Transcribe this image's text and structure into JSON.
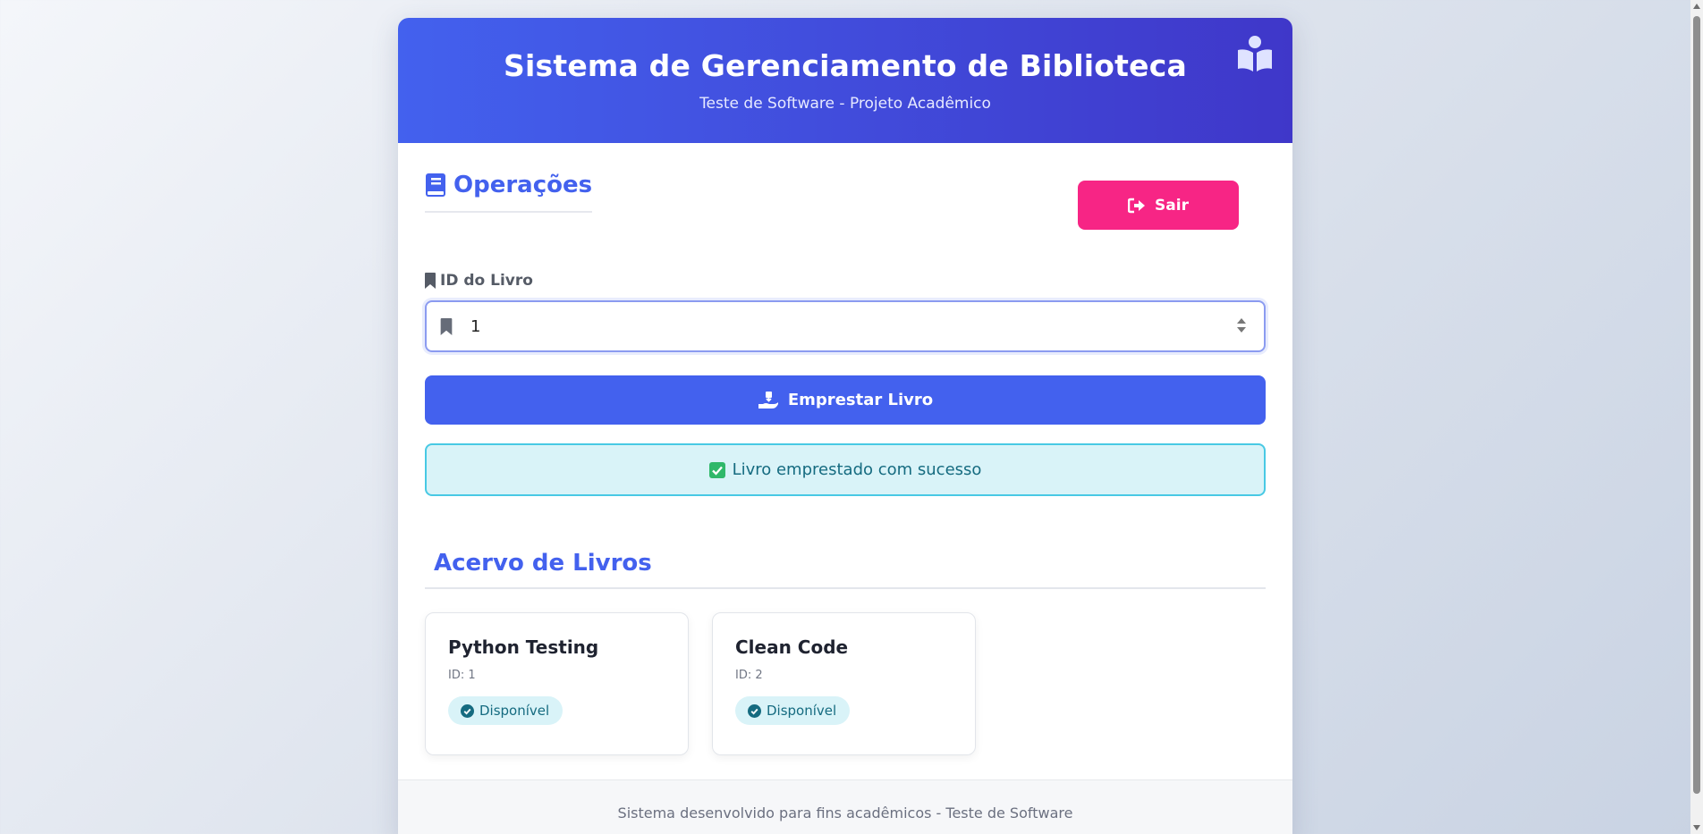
{
  "header": {
    "title": "Sistema de Gerenciamento de Biblioteca",
    "subtitle": "Teste de Software - Projeto Acadêmico"
  },
  "operations": {
    "title": "Operações",
    "logout_label": "Sair"
  },
  "form": {
    "book_id_label": "ID do Livro",
    "book_id_value": "1",
    "lend_button_label": "Emprestar Livro"
  },
  "alert": {
    "message": "Livro emprestado com sucesso"
  },
  "collection": {
    "title": "Acervo de Livros",
    "books": [
      {
        "title": "Python Testing",
        "id_text": "ID: 1",
        "status": "Disponível"
      },
      {
        "title": "Clean Code",
        "id_text": "ID: 2",
        "status": "Disponível"
      }
    ]
  },
  "footer": {
    "text": "Sistema desenvolvido para fins acadêmicos - Teste de Software"
  },
  "colors": {
    "primary": "#4361ee",
    "header_gradient_end": "#3f37c9",
    "logout": "#f72585",
    "alert_bg": "#d9f3f8",
    "alert_border": "#48c9e4"
  }
}
